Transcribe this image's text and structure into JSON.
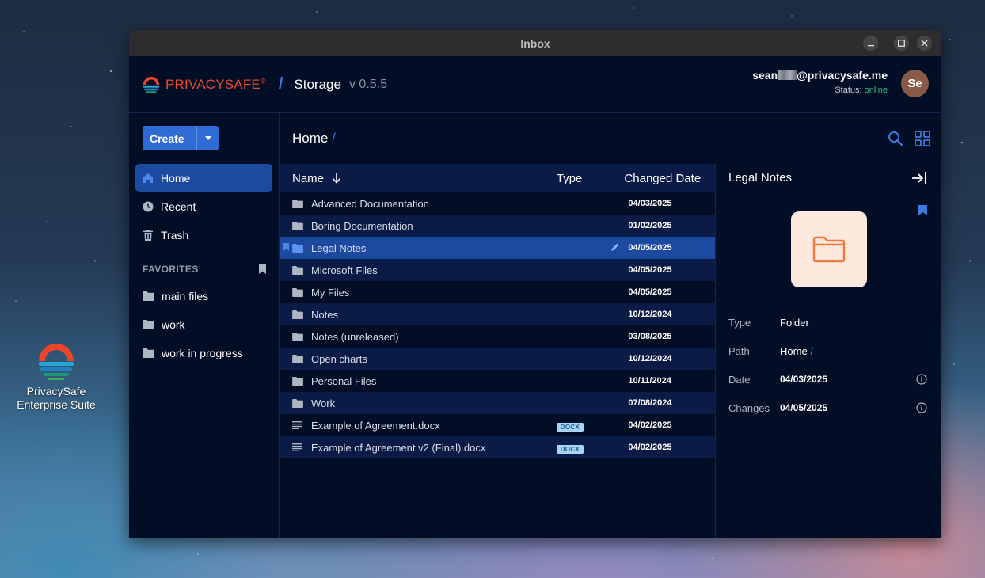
{
  "desktop": {
    "icon_label_line1": "PrivacySafe",
    "icon_label_line2": "Enterprise Suite"
  },
  "window": {
    "title": "Inbox",
    "controls": [
      "minimize",
      "maximize",
      "close"
    ]
  },
  "header": {
    "brand": "PRIVACYSAFE",
    "brand_mark": "®",
    "separator": "/",
    "app_name": "Storage",
    "version": "v 0.5.5",
    "user_email_prefix": "sean",
    "user_email_domain": "@privacysafe.me",
    "status_label": "Status:",
    "status_value": "online",
    "avatar_initials": "Se",
    "colors": {
      "brand": "#e84a2a",
      "accent": "#2e6bd4",
      "online": "#2ec27e"
    }
  },
  "sidebar": {
    "create_label": "Create",
    "nav": [
      {
        "label": "Home",
        "icon": "home-icon",
        "active": true
      },
      {
        "label": "Recent",
        "icon": "clock-icon",
        "active": false
      },
      {
        "label": "Trash",
        "icon": "trash-icon",
        "active": false
      }
    ],
    "favorites_title": "FAVORITES",
    "favorites": [
      "main files",
      "work",
      "work in progress"
    ]
  },
  "breadcrumb": {
    "current": "Home",
    "separator": "/"
  },
  "table": {
    "headers": {
      "name": "Name",
      "type": "Type",
      "date": "Changed Date"
    },
    "rows": [
      {
        "name": "Advanced Documentation",
        "kind": "folder",
        "type": "",
        "date": "04/03/2025"
      },
      {
        "name": "Boring Documentation",
        "kind": "folder",
        "type": "",
        "date": "01/02/2025"
      },
      {
        "name": "Legal Notes",
        "kind": "folder",
        "type": "",
        "date": "04/05/2025",
        "selected": true,
        "bookmarked": true
      },
      {
        "name": "Microsoft Files",
        "kind": "folder",
        "type": "",
        "date": "04/05/2025"
      },
      {
        "name": "My Files",
        "kind": "folder",
        "type": "",
        "date": "04/05/2025"
      },
      {
        "name": "Notes",
        "kind": "folder",
        "type": "",
        "date": "10/12/2024"
      },
      {
        "name": "Notes (unreleased)",
        "kind": "folder",
        "type": "",
        "date": "03/08/2025"
      },
      {
        "name": "Open charts",
        "kind": "folder",
        "type": "",
        "date": "10/12/2024"
      },
      {
        "name": "Personal Files",
        "kind": "folder",
        "type": "",
        "date": "10/11/2024"
      },
      {
        "name": "Work",
        "kind": "folder",
        "type": "",
        "date": "07/08/2024"
      },
      {
        "name": "Example of Agreement.docx",
        "kind": "file",
        "type": "DOCX",
        "date": "04/02/2025"
      },
      {
        "name": "Example of Agreement v2 (Final).docx",
        "kind": "file",
        "type": "DOCX",
        "date": "04/02/2025"
      }
    ]
  },
  "details": {
    "title": "Legal Notes",
    "type_label": "Type",
    "type_value": "Folder",
    "path_label": "Path",
    "path_value": "Home",
    "path_sep": "/",
    "date_label": "Date",
    "date_value": "04/03/2025",
    "changes_label": "Changes",
    "changes_value": "04/05/2025"
  }
}
